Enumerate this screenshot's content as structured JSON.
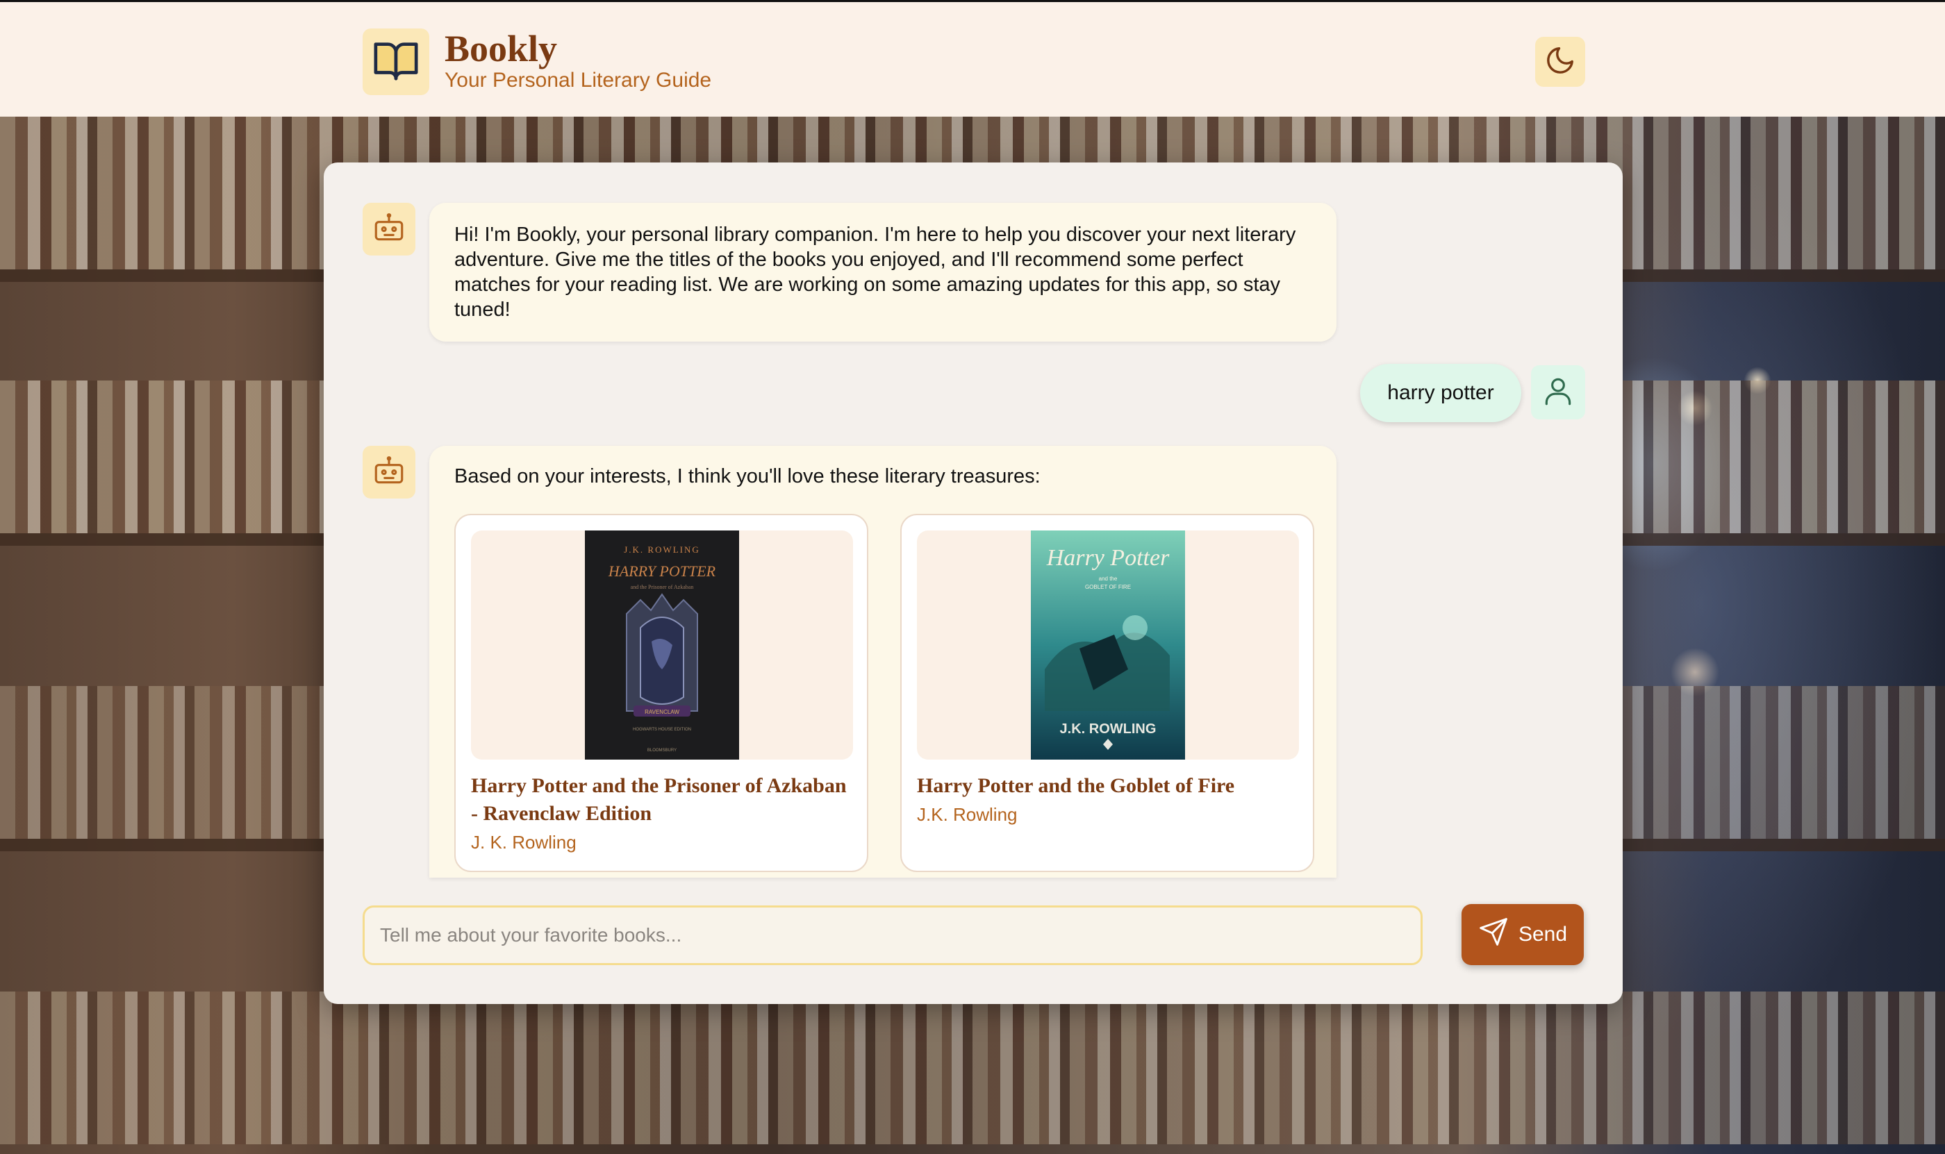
{
  "header": {
    "brand_name": "Bookly",
    "tagline": "Your Personal Literary Guide",
    "logo_icon": "open-book-icon",
    "theme_toggle_icon": "moon-icon"
  },
  "chat": {
    "messages": [
      {
        "sender": "bot",
        "avatar_icon": "robot-icon",
        "text": "Hi! I'm Bookly, your personal library companion. I'm here to help you discover your next literary adventure. Give me the titles of the books you enjoyed, and I'll recommend some perfect matches for your reading list. We are working on some amazing updates for this app, so stay tuned!"
      },
      {
        "sender": "user",
        "avatar_icon": "user-icon",
        "text": "harry potter"
      },
      {
        "sender": "bot",
        "avatar_icon": "robot-icon",
        "text": "Based on your interests, I think you'll love these literary treasures:",
        "books": [
          {
            "title": "Harry Potter and the Prisoner of Azkaban - Ravenclaw Edition",
            "author": "J. K. Rowling",
            "cover_text": [
              "J.K. ROWLING",
              "HARRY POTTER",
              "and the Prisoner of Azkaban",
              "RAVENCLAW",
              "HOGWARTS HOUSE EDITION",
              "BLOOMSBURY"
            ]
          },
          {
            "title": "Harry Potter and the Goblet of Fire",
            "author": "J.K. Rowling",
            "cover_text": [
              "Harry Potter",
              "and the",
              "GOBLET OF FIRE",
              "J.K. ROWLING"
            ]
          }
        ]
      }
    ]
  },
  "composer": {
    "placeholder": "Tell me about your favorite books...",
    "value": "",
    "send_label": "Send",
    "send_icon": "paper-plane-icon"
  },
  "colors": {
    "accent": "#b2541c",
    "brand_text": "#7a3a12",
    "header_bg": "#fbf1e8",
    "bot_bubble": "#fdf8e8",
    "user_bubble": "#dff7ea"
  }
}
